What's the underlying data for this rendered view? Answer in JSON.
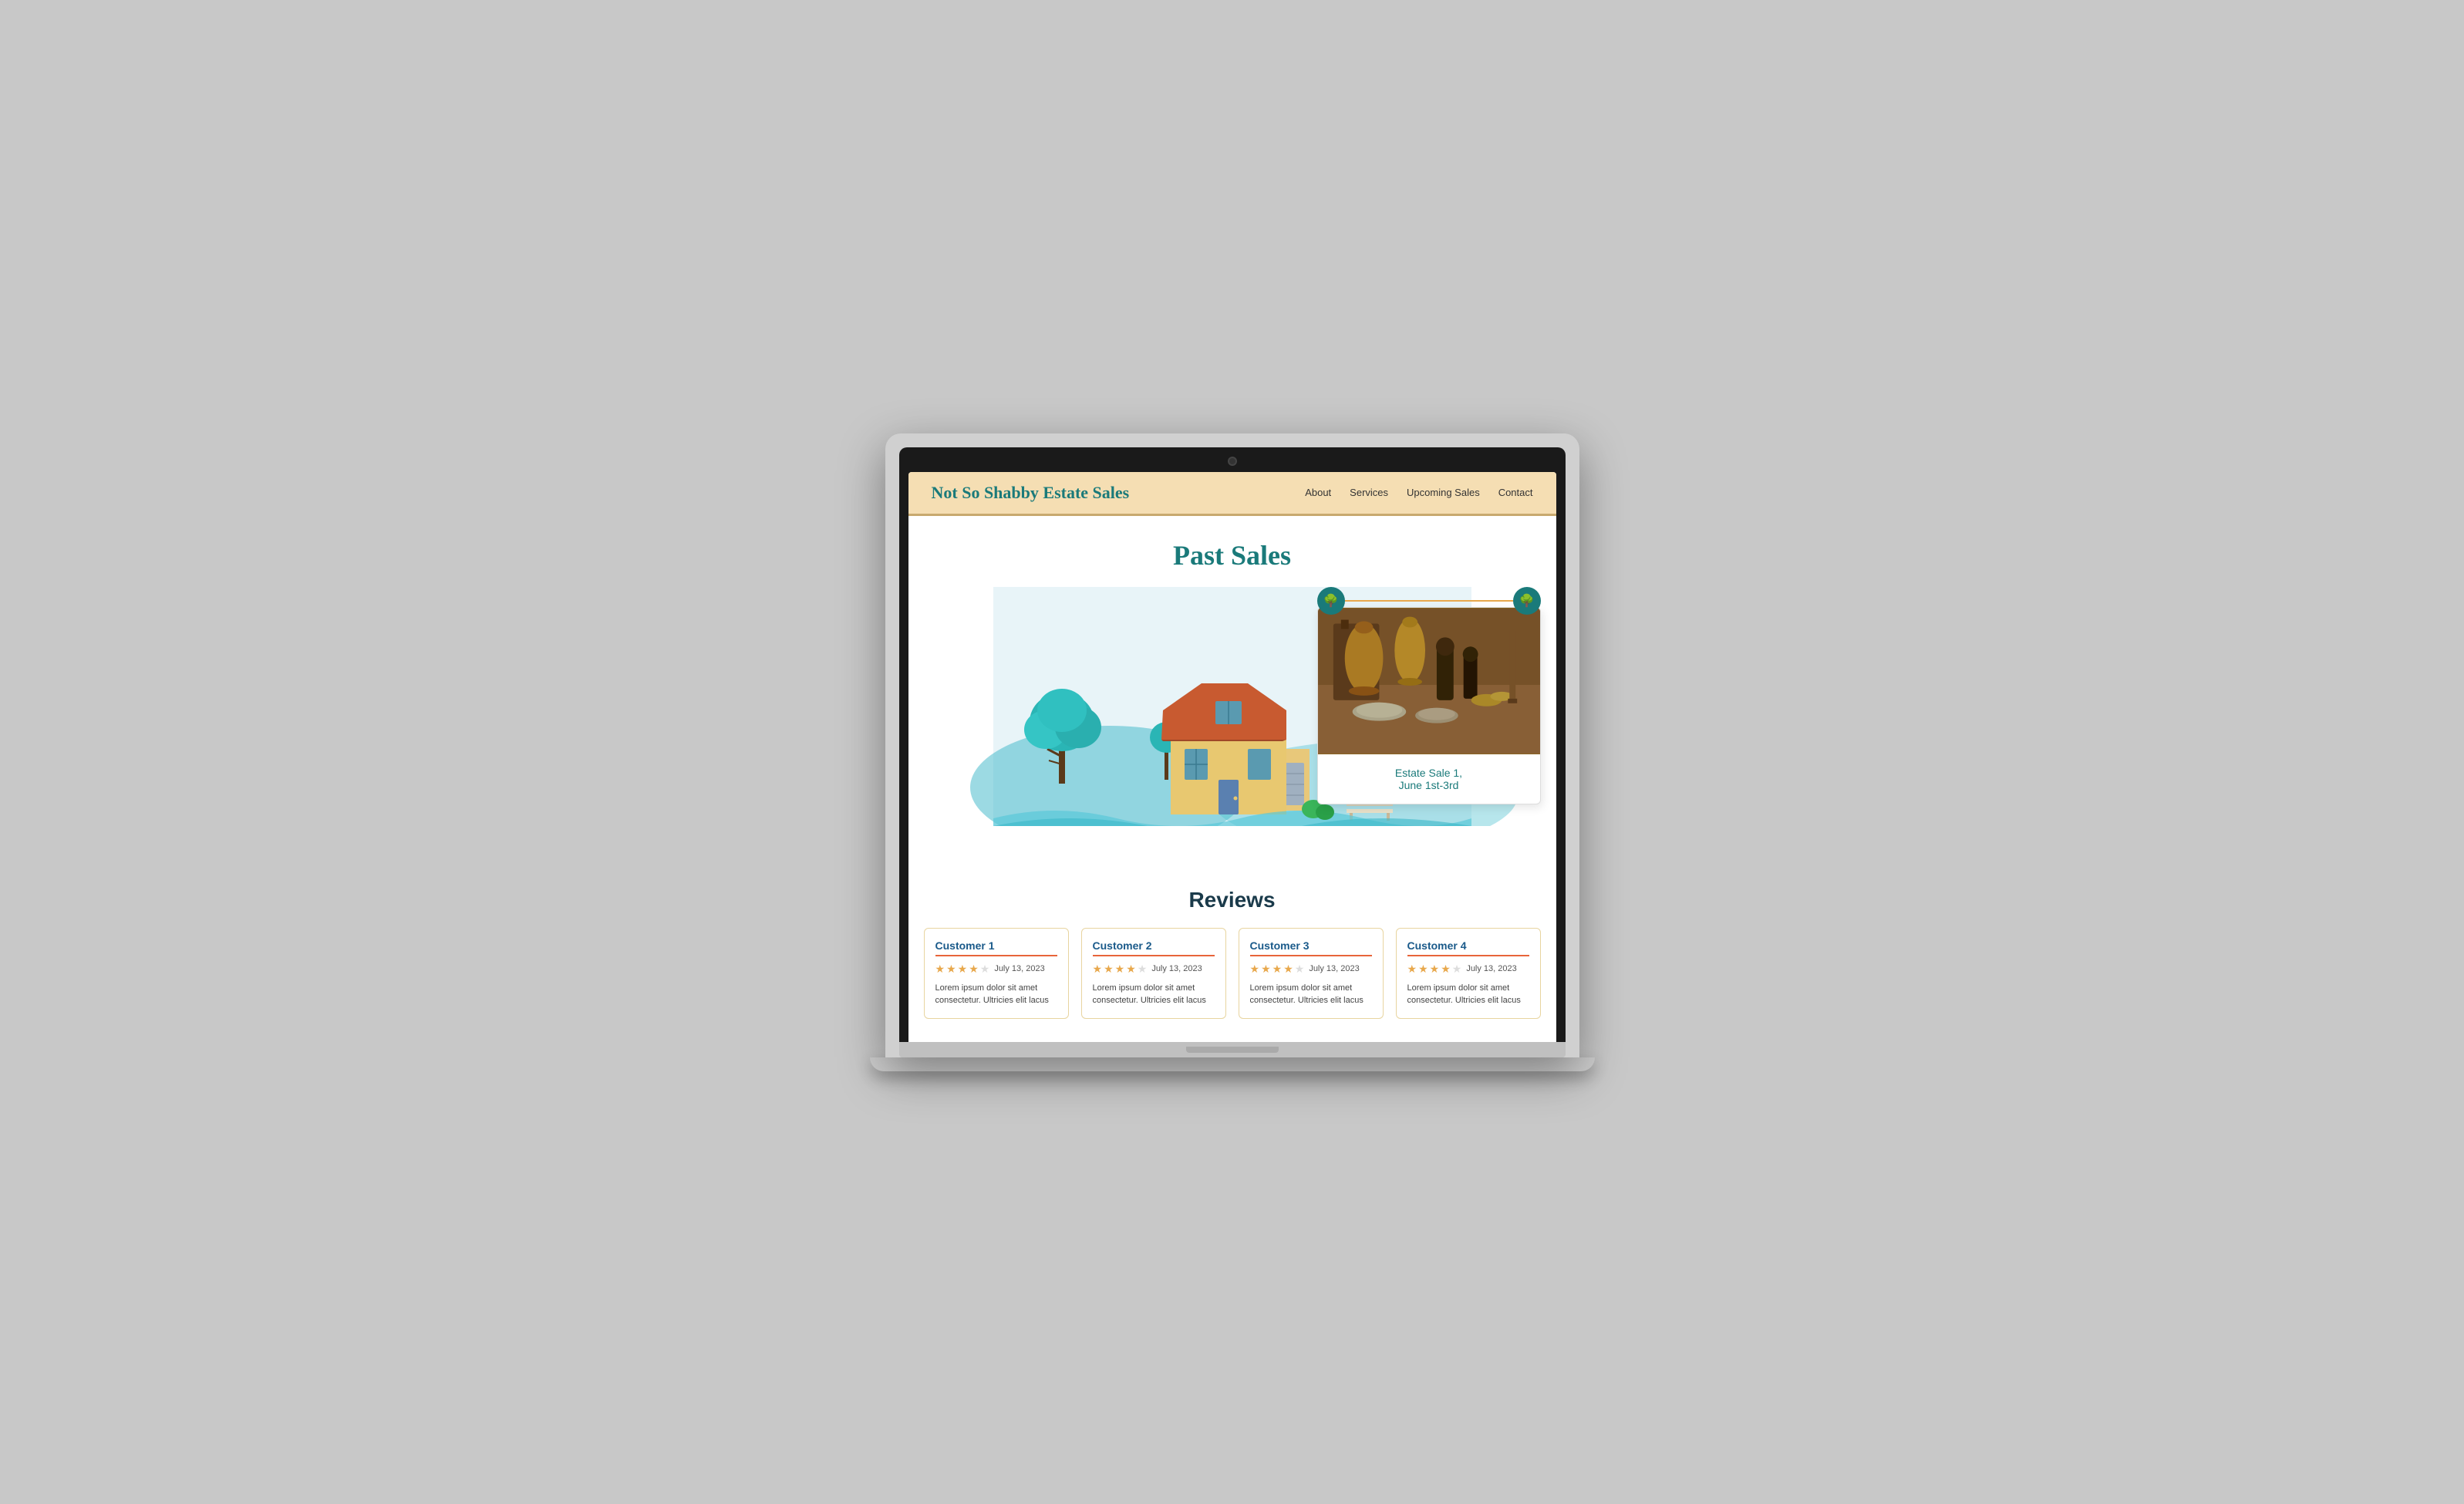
{
  "site": {
    "logo": "Not So Shabby Estate Sales",
    "nav": {
      "links": [
        "About",
        "Services",
        "Upcoming Sales",
        "Contact"
      ]
    }
  },
  "past_sales": {
    "title": "Past Sales",
    "card": {
      "title": "Estate Sale 1,",
      "subtitle": "June 1st-3rd"
    }
  },
  "reviews": {
    "title": "Reviews",
    "items": [
      {
        "customer": "Customer 1",
        "date": "July 13, 2023",
        "stars": 4,
        "text": "Lorem ipsum dolor sit amet consectetur. Ultricies elit lacus"
      },
      {
        "customer": "Customer 2",
        "date": "July 13, 2023",
        "stars": 4,
        "text": "Lorem ipsum dolor sit amet consectetur. Ultricies elit lacus"
      },
      {
        "customer": "Customer 3",
        "date": "July 13, 2023",
        "stars": 4,
        "text": "Lorem ipsum dolor sit amet consectetur. Ultricies elit lacus"
      },
      {
        "customer": "Customer 4",
        "date": "July 13, 2023",
        "stars": 4,
        "text": "Lorem ipsum dolor sit amet consectetur. Ultricies elit lacus"
      }
    ]
  },
  "icons": {
    "tree": "🌳",
    "star_filled": "★",
    "star_empty": "★"
  }
}
